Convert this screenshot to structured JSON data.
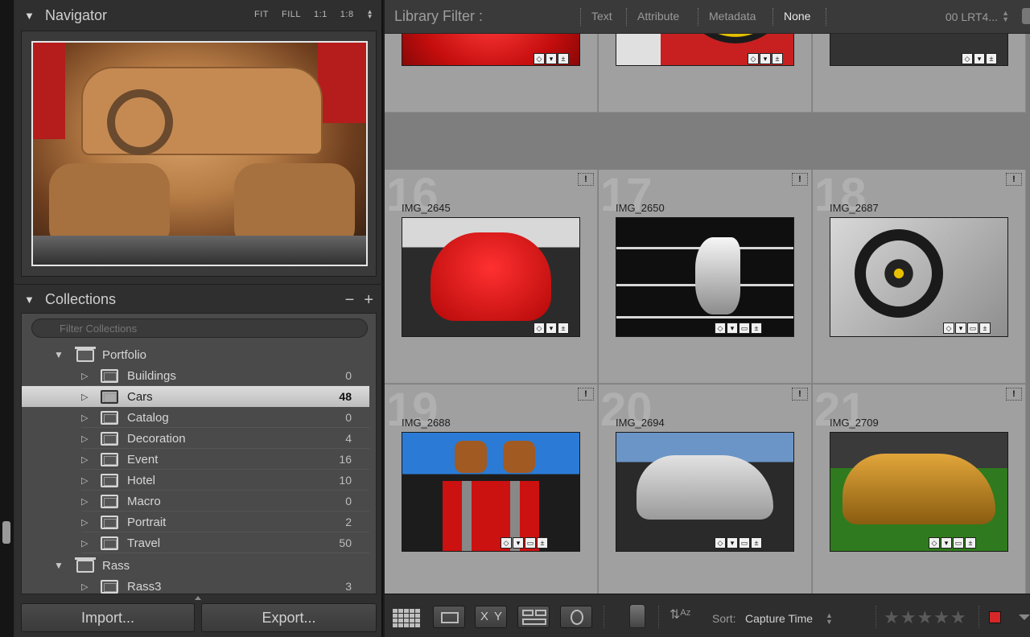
{
  "navigator": {
    "title": "Navigator",
    "options": [
      "FIT",
      "FILL",
      "1:1",
      "1:8"
    ]
  },
  "collections": {
    "title": "Collections",
    "remove_label": "−",
    "add_label": "+",
    "filter_placeholder": "Filter Collections",
    "sets": [
      {
        "name": "Portfolio"
      },
      {
        "name": "Rass"
      }
    ],
    "items": [
      {
        "name": "Buildings",
        "count": "0"
      },
      {
        "name": "Cars",
        "count": "48"
      },
      {
        "name": "Catalog",
        "count": "0"
      },
      {
        "name": "Decoration",
        "count": "4"
      },
      {
        "name": "Event",
        "count": "16"
      },
      {
        "name": "Hotel",
        "count": "10"
      },
      {
        "name": "Macro",
        "count": "0"
      },
      {
        "name": "Portrait",
        "count": "2"
      },
      {
        "name": "Travel",
        "count": "50"
      },
      {
        "name": "Rass3",
        "count": "3"
      }
    ]
  },
  "buttons": {
    "import": "Import...",
    "export": "Export..."
  },
  "filter_bar": {
    "title": "Library Filter :",
    "tabs": [
      "Text",
      "Attribute",
      "Metadata",
      "None"
    ],
    "preset": "00 LRT4..."
  },
  "grid": {
    "cells": [
      {
        "num": "",
        "name": "",
        "flag": ""
      },
      {
        "num": "",
        "name": "",
        "flag": ""
      },
      {
        "num": "",
        "name": "",
        "flag": ""
      },
      {
        "num": "16",
        "name": "IMG_2645",
        "flag": "!"
      },
      {
        "num": "17",
        "name": "IMG_2650",
        "flag": "!"
      },
      {
        "num": "18",
        "name": "IMG_2687",
        "flag": "!"
      },
      {
        "num": "19",
        "name": "IMG_2688",
        "flag": "!"
      },
      {
        "num": "20",
        "name": "IMG_2694",
        "flag": "!"
      },
      {
        "num": "21",
        "name": "IMG_2709",
        "flag": "!"
      }
    ]
  },
  "toolbar": {
    "compare_x": "X",
    "compare_y": "Y",
    "sort_label": "Sort:",
    "sort_value": "Capture Time",
    "stars": "★★★★★",
    "icons": [
      "grid-icon",
      "loupe-icon",
      "compare-icon",
      "survey-icon",
      "people-icon",
      "spray-can-icon",
      "sort-direction-icon"
    ]
  },
  "colors": {
    "label_red": "#d62828",
    "selection": "#cfcfcf"
  }
}
